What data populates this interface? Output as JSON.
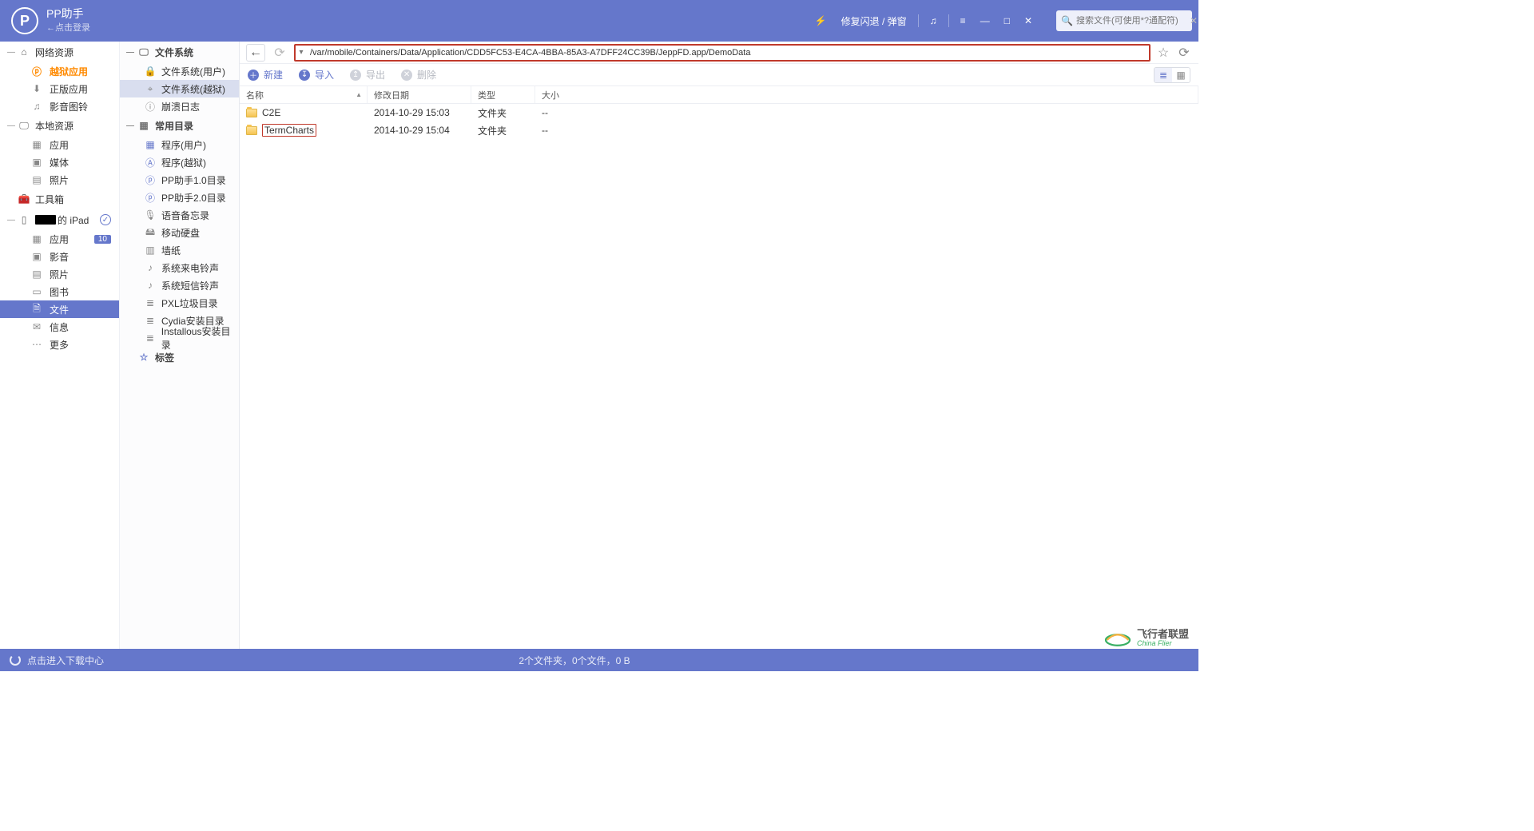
{
  "titlebar": {
    "app_name": "PP助手",
    "app_sub": "←点击登录",
    "fix_label": "修复闪退 / 弹窗",
    "search_placeholder": "搜索文件(可使用*?通配符)"
  },
  "sidebar_left": {
    "sections": [
      {
        "label": "网络资源",
        "items": [
          {
            "label": "越狱应用",
            "icon": "⬇",
            "accent": true
          },
          {
            "label": "正版应用",
            "icon": "⬇"
          },
          {
            "label": "影音图铃",
            "icon": "♫"
          }
        ]
      },
      {
        "label": "本地资源",
        "items": [
          {
            "label": "应用",
            "icon": "▦"
          },
          {
            "label": "媒体",
            "icon": "▣"
          },
          {
            "label": "照片",
            "icon": "▤"
          }
        ]
      },
      {
        "label": "工具箱",
        "standalone": true,
        "icon": "🧰"
      },
      {
        "label": "的 iPad",
        "device": true,
        "check": true,
        "items": [
          {
            "label": "应用",
            "icon": "▦",
            "badge": "10"
          },
          {
            "label": "影音",
            "icon": "▣"
          },
          {
            "label": "照片",
            "icon": "▤"
          },
          {
            "label": "图书",
            "icon": "▭"
          },
          {
            "label": "文件",
            "icon": "🗎",
            "selected": true
          },
          {
            "label": "信息",
            "icon": "✉"
          },
          {
            "label": "更多",
            "icon": "⋯"
          }
        ]
      }
    ]
  },
  "sidebar_tree": {
    "groups": [
      {
        "label": "文件系统",
        "items": [
          {
            "label": "文件系统(用户)",
            "icon": "🔒"
          },
          {
            "label": "文件系统(越狱)",
            "icon": "⌖",
            "selected": true
          },
          {
            "label": "崩溃日志",
            "icon": "ⓘ"
          }
        ]
      },
      {
        "label": "常用目录",
        "items": [
          {
            "label": "程序(用户)",
            "icon": "▦",
            "blue": true
          },
          {
            "label": "程序(越狱)",
            "icon": "Ⓐ",
            "blue": true
          },
          {
            "label": "PP助手1.0目录",
            "icon": "ⓟ",
            "blue": true
          },
          {
            "label": "PP助手2.0目录",
            "icon": "ⓟ",
            "blue": true
          },
          {
            "label": "语音备忘录",
            "icon": "🎙"
          },
          {
            "label": "移动硬盘",
            "icon": "🖴"
          },
          {
            "label": "墙纸",
            "icon": "▥"
          },
          {
            "label": "系统来电铃声",
            "icon": "♪"
          },
          {
            "label": "系统短信铃声",
            "icon": "♪"
          },
          {
            "label": "PXL垃圾目录",
            "icon": "≣"
          },
          {
            "label": "Cydia安装目录",
            "icon": "≣"
          },
          {
            "label": "Installous安装目录",
            "icon": "≣"
          }
        ]
      },
      {
        "label": "标签",
        "star": true
      }
    ]
  },
  "pathbar": {
    "value": "/var/mobile/Containers/Data/Application/CDD5FC53-E4CA-4BBA-85A3-A7DFF24CC39B/JeppFD.app/DemoData"
  },
  "cmdbar": {
    "new": "新建",
    "import": "导入",
    "export": "导出",
    "delete": "删除"
  },
  "columns": {
    "name": "名称",
    "date": "修改日期",
    "type": "类型",
    "size": "大小"
  },
  "rows": [
    {
      "name": "C2E",
      "date": "2014-10-29 15:03",
      "type": "文件夹",
      "size": "--"
    },
    {
      "name": "TermCharts",
      "date": "2014-10-29 15:04",
      "type": "文件夹",
      "size": "--",
      "highlight": true
    }
  ],
  "statusbar": {
    "download_center": "点击进入下载中心",
    "summary": "2个文件夹，0个文件，0 B"
  },
  "watermark": {
    "title": "飞行者联盟",
    "sub": "China Flier"
  }
}
